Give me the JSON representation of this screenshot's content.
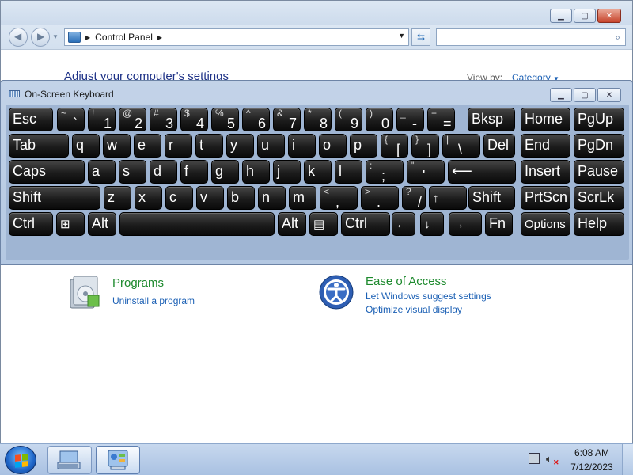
{
  "control_panel": {
    "address": {
      "location": "Control Panel"
    },
    "search": {
      "placeholder": ""
    },
    "heading": "Adjust your computer's settings",
    "view_by_label": "View by:",
    "view_by_value": "Category",
    "categories": [
      {
        "title": "Programs",
        "links": [
          "Uninstall a program"
        ]
      },
      {
        "title": "Ease of Access",
        "links": [
          "Let Windows suggest settings",
          "Optimize visual display"
        ]
      }
    ]
  },
  "osk": {
    "title": "On-Screen Keyboard",
    "rows": [
      [
        {
          "label": "Esc"
        },
        {
          "top": "~",
          "bottom": "`"
        },
        {
          "top": "!",
          "bottom": "1"
        },
        {
          "top": "@",
          "bottom": "2"
        },
        {
          "top": "#",
          "bottom": "3"
        },
        {
          "top": "$",
          "bottom": "4"
        },
        {
          "top": "%",
          "bottom": "5"
        },
        {
          "top": "^",
          "bottom": "6"
        },
        {
          "top": "&",
          "bottom": "7"
        },
        {
          "top": "*",
          "bottom": "8"
        },
        {
          "top": "(",
          "bottom": "9"
        },
        {
          "top": ")",
          "bottom": "0"
        },
        {
          "top": "_",
          "bottom": "-"
        },
        {
          "top": "+",
          "bottom": "="
        },
        {
          "label": "Bksp"
        },
        {
          "label": "Home"
        },
        {
          "label": "PgUp"
        }
      ],
      [
        {
          "label": "Tab"
        },
        {
          "label": "q"
        },
        {
          "label": "w"
        },
        {
          "label": "e"
        },
        {
          "label": "r"
        },
        {
          "label": "t"
        },
        {
          "label": "y"
        },
        {
          "label": "u"
        },
        {
          "label": "i"
        },
        {
          "label": "o"
        },
        {
          "label": "p"
        },
        {
          "top": "{",
          "bottom": "["
        },
        {
          "top": "}",
          "bottom": "]"
        },
        {
          "top": "|",
          "bottom": "\\"
        },
        {
          "label": "Del"
        },
        {
          "label": "End"
        },
        {
          "label": "PgDn"
        }
      ],
      [
        {
          "label": "Caps"
        },
        {
          "label": "a"
        },
        {
          "label": "s"
        },
        {
          "label": "d"
        },
        {
          "label": "f"
        },
        {
          "label": "g"
        },
        {
          "label": "h"
        },
        {
          "label": "j"
        },
        {
          "label": "k"
        },
        {
          "label": "l"
        },
        {
          "top": ":",
          "bottom": ";"
        },
        {
          "top": "\"",
          "bottom": "'"
        },
        {
          "label": "⟵"
        },
        {
          "label": "Insert"
        },
        {
          "label": "Pause"
        }
      ],
      [
        {
          "label": "Shift"
        },
        {
          "label": "z"
        },
        {
          "label": "x"
        },
        {
          "label": "c"
        },
        {
          "label": "v"
        },
        {
          "label": "b"
        },
        {
          "label": "n"
        },
        {
          "label": "m"
        },
        {
          "top": "<",
          "bottom": ","
        },
        {
          "top": ">",
          "bottom": "."
        },
        {
          "top": "?",
          "bottom": "/"
        },
        {
          "label": "↑"
        },
        {
          "label": "Shift"
        },
        {
          "label": "PrtScn"
        },
        {
          "label": "ScrLk"
        }
      ],
      [
        {
          "label": "Ctrl"
        },
        {
          "label": "⊞"
        },
        {
          "label": "Alt"
        },
        {
          "label": ""
        },
        {
          "label": "Alt"
        },
        {
          "label": "▤"
        },
        {
          "label": "Ctrl"
        },
        {
          "label": "←"
        },
        {
          "label": "↓"
        },
        {
          "label": "→"
        },
        {
          "label": "Fn"
        },
        {
          "label": "Options"
        },
        {
          "label": "Help"
        }
      ]
    ]
  },
  "taskbar": {
    "time": "6:08 AM",
    "date": "7/12/2023"
  },
  "colors": {
    "link": "#1a5fb4",
    "category_title": "#1e8a2e",
    "heading": "#1e3287",
    "key_face": "#1c1c1c",
    "osk_frame": "#b4c8e2"
  },
  "icons": [
    "back-arrow-icon",
    "forward-arrow-icon",
    "control-panel-icon",
    "refresh-icon",
    "search-icon",
    "programs-icon",
    "ease-of-access-icon",
    "keyboard-icon",
    "windows-flag-icon",
    "network-icon",
    "volume-muted-icon"
  ]
}
